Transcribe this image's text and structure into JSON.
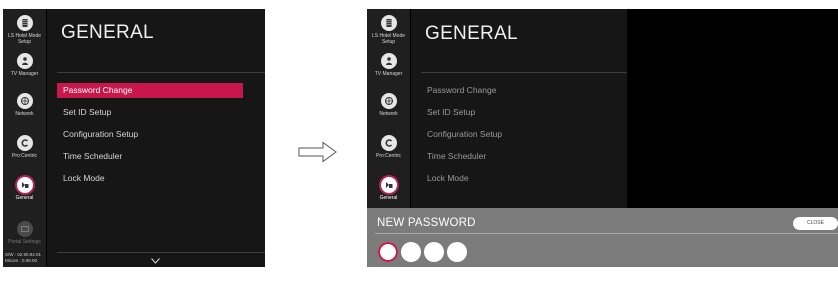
{
  "sidebar": {
    "items": [
      {
        "label": "LS Hotel Mode Setup",
        "icon": "hotel-mode-icon"
      },
      {
        "label": "TV Manager",
        "icon": "tv-manager-icon"
      },
      {
        "label": "Network",
        "icon": "network-icon"
      },
      {
        "label": "Pro:Centric",
        "icon": "procentric-icon"
      },
      {
        "label": "General",
        "icon": "general-icon"
      },
      {
        "label": "Portal Settings",
        "icon": "portal-settings-icon"
      }
    ],
    "sw_info": "S/W : 02.90.94.01\nMicom : 0.06.00"
  },
  "main": {
    "title": "GENERAL",
    "menu": [
      "Password Change",
      "Set ID Setup",
      "Configuration Setup",
      "Time Scheduler",
      "Lock Mode"
    ],
    "selected_index": 0
  },
  "dialog": {
    "title": "NEW PASSWORD",
    "close_label": "CLOSE",
    "pin_length": 4,
    "active_digit": 1
  },
  "colors": {
    "accent": "#c8174c",
    "dialog_bg": "#7b7b7b"
  }
}
